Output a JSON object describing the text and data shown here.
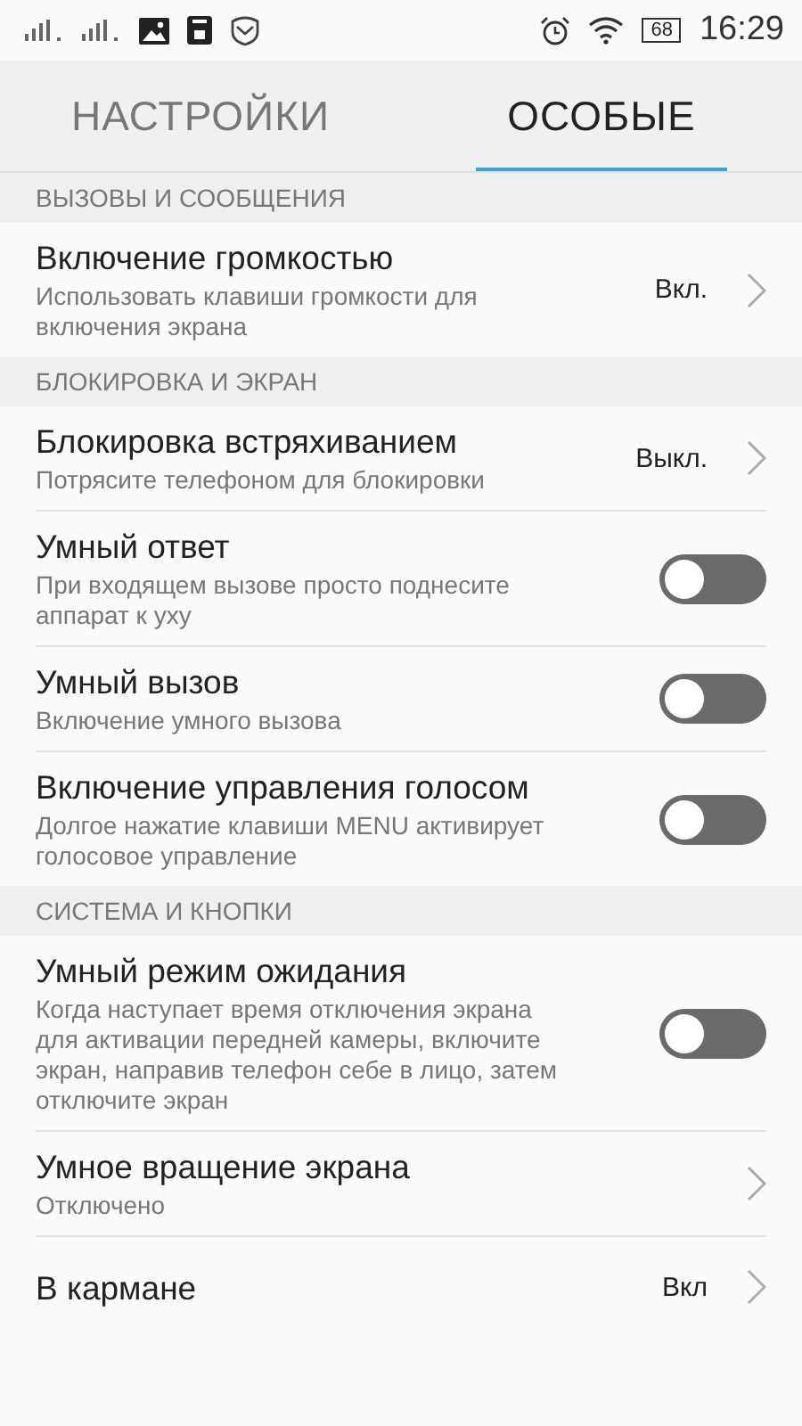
{
  "status_bar": {
    "time": "16:29",
    "battery": "68"
  },
  "tabs": [
    {
      "label": "НАСТРОЙКИ",
      "selected": false
    },
    {
      "label": "ОСОБЫЕ",
      "selected": true
    }
  ],
  "sections": [
    {
      "header": "ВЫЗОВЫ И СООБЩЕНИЯ",
      "items": [
        {
          "kind": "value",
          "title": "Включение громкостью",
          "subtitle": "Использовать клавиши громкости для включения экрана",
          "value": "Вкл."
        }
      ]
    },
    {
      "header": "БЛОКИРОВКА И ЭКРАН",
      "items": [
        {
          "kind": "value",
          "title": "Блокировка встряхиванием",
          "subtitle": "Потрясите телефоном для блокировки",
          "value": "Выкл."
        },
        {
          "kind": "toggle",
          "title": "Умный ответ",
          "subtitle": "При входящем вызове просто поднесите аппарат к уху",
          "on": false
        },
        {
          "kind": "toggle",
          "title": "Умный вызов",
          "subtitle": "Включение умного вызова",
          "on": false
        },
        {
          "kind": "toggle",
          "title": "Включение управления голосом",
          "subtitle": "Долгое нажатие клавиши MENU активирует голосовое управление",
          "on": false
        }
      ]
    },
    {
      "header": "СИСТЕМА И КНОПКИ",
      "items": [
        {
          "kind": "toggle",
          "title": "Умный режим ожидания",
          "subtitle": "Когда наступает время отключения экрана для активации передней камеры, включите экран, направив телефон себе в лицо, затем отключите экран",
          "on": false
        },
        {
          "kind": "link",
          "title": "Умное вращение экрана",
          "subtitle": "Отключено"
        },
        {
          "kind": "value",
          "title": "В кармане",
          "value": "Вкл"
        }
      ]
    }
  ]
}
